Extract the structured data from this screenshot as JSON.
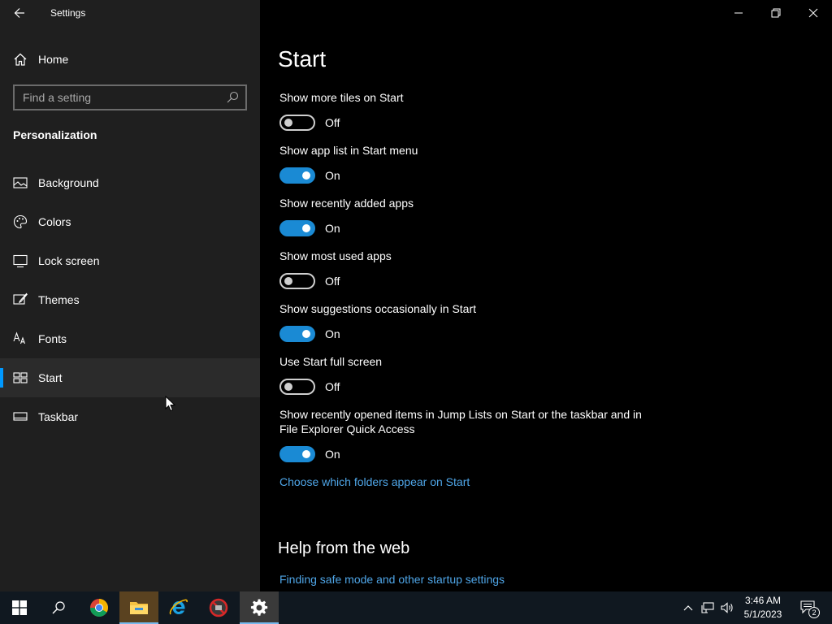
{
  "window": {
    "title": "Settings",
    "back_icon": "arrow-left-icon",
    "controls": [
      "minimize-icon",
      "restore-icon",
      "close-icon"
    ]
  },
  "sidebar": {
    "home_label": "Home",
    "search_placeholder": "Find a setting",
    "section_title": "Personalization",
    "items": [
      {
        "label": "Background",
        "icon": "picture-icon",
        "selected": false
      },
      {
        "label": "Colors",
        "icon": "palette-icon",
        "selected": false
      },
      {
        "label": "Lock screen",
        "icon": "monitor-lock-icon",
        "selected": false
      },
      {
        "label": "Themes",
        "icon": "brush-icon",
        "selected": false
      },
      {
        "label": "Fonts",
        "icon": "font-icon",
        "selected": false
      },
      {
        "label": "Start",
        "icon": "start-grid-icon",
        "selected": true
      },
      {
        "label": "Taskbar",
        "icon": "taskbar-icon",
        "selected": false
      }
    ]
  },
  "main": {
    "title": "Start",
    "settings": [
      {
        "label": "Show more tiles on Start",
        "state": "Off"
      },
      {
        "label": "Show app list in Start menu",
        "state": "On"
      },
      {
        "label": "Show recently added apps",
        "state": "On"
      },
      {
        "label": "Show most used apps",
        "state": "Off"
      },
      {
        "label": "Show suggestions occasionally in Start",
        "state": "On"
      },
      {
        "label": "Use Start full screen",
        "state": "Off"
      },
      {
        "label": "Show recently opened items in Jump Lists on Start or the taskbar and in File Explorer Quick Access",
        "state": "On"
      }
    ],
    "folders_link": "Choose which folders appear on Start",
    "help_title": "Help from the web",
    "help_link": "Finding safe mode and other startup settings"
  },
  "taskbar": {
    "apps": [
      "windows-start-icon",
      "search-icon",
      "chrome-icon",
      "file-explorer-icon",
      "internet-explorer-icon",
      "blocked-app-icon",
      "settings-gear-icon"
    ],
    "time": "3:46 AM",
    "date": "5/1/2023",
    "notification_count": "2"
  },
  "colors": {
    "accent": "#0099ff",
    "toggle_on": "#1a8ad4",
    "link": "#4fa6e8",
    "sidebar_bg": "#1f1f1f",
    "main_bg": "#000000"
  }
}
